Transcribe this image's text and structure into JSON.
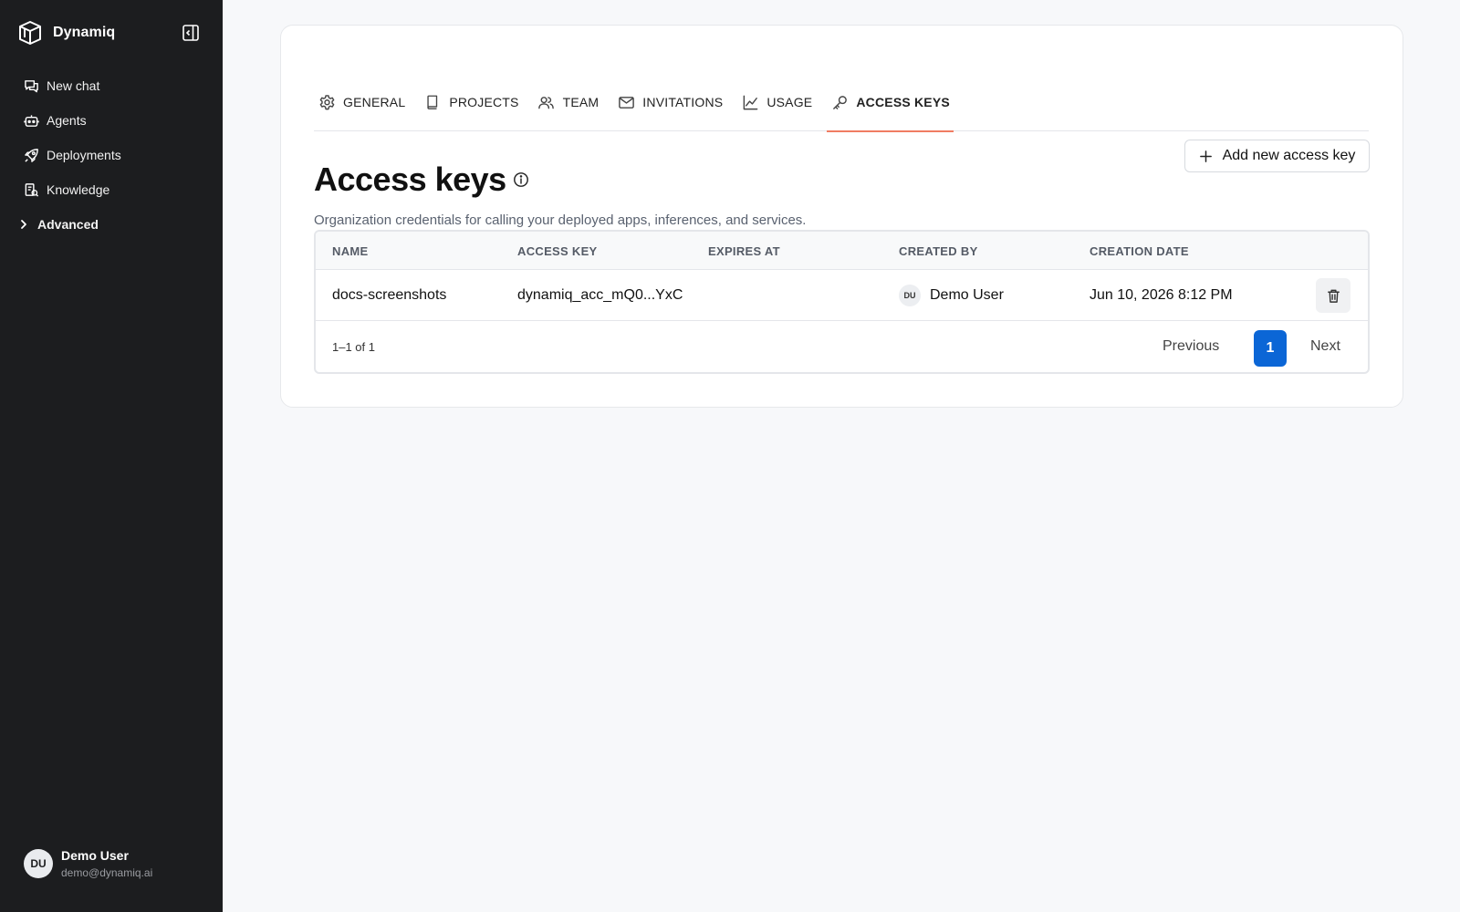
{
  "app": {
    "name": "Dynamiq"
  },
  "sidebar": {
    "items": [
      {
        "label": "New chat",
        "icon": "chat-icon"
      },
      {
        "label": "Agents",
        "icon": "bot-icon"
      },
      {
        "label": "Deployments",
        "icon": "rocket-icon"
      },
      {
        "label": "Knowledge",
        "icon": "knowledge-icon"
      },
      {
        "label": "Advanced",
        "icon": "chevron-right-icon"
      }
    ],
    "user": {
      "initials": "DU",
      "name": "Demo User",
      "email": "demo@dynamiq.ai"
    }
  },
  "tabs": [
    {
      "label": "GENERAL",
      "icon": "gear-icon"
    },
    {
      "label": "PROJECTS",
      "icon": "book-icon"
    },
    {
      "label": "TEAM",
      "icon": "users-icon"
    },
    {
      "label": "INVITATIONS",
      "icon": "mail-icon"
    },
    {
      "label": "USAGE",
      "icon": "chart-icon"
    },
    {
      "label": "ACCESS KEYS",
      "icon": "key-icon",
      "active": true
    }
  ],
  "page": {
    "title": "Access keys",
    "subtitle": "Organization credentials for calling your deployed apps, inferences, and services.",
    "add_button": "Add new access key"
  },
  "table": {
    "columns": [
      "NAME",
      "ACCESS KEY",
      "EXPIRES AT",
      "CREATED BY",
      "CREATION DATE"
    ],
    "rows": [
      {
        "name": "docs-screenshots",
        "access_key": "dynamiq_acc_mQ0...YxC",
        "expires_at": "",
        "created_by_initials": "DU",
        "created_by": "Demo User",
        "creation_date": "Jun 10, 2026 8:12 PM"
      }
    ],
    "count": "1–1 of 1",
    "pagination": {
      "previous": "Previous",
      "current": "1",
      "next": "Next"
    }
  },
  "colors": {
    "sidebar_bg": "#1c1d1f",
    "active_tab_underline": "#f07c62",
    "primary": "#0b66d6"
  }
}
